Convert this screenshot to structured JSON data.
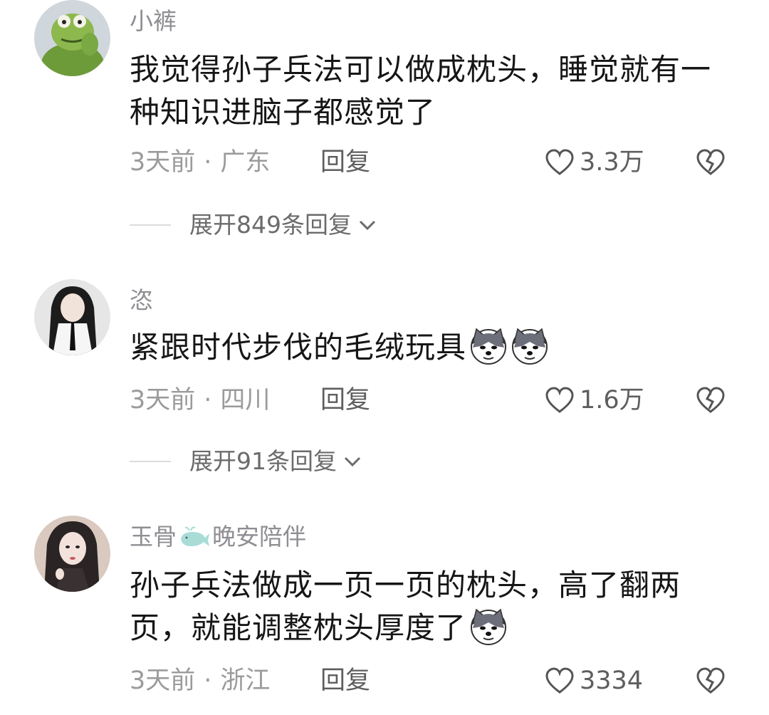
{
  "comments": [
    {
      "username": "小裤",
      "text": "我觉得孙子兵法可以做成枕头，睡觉就有一种知识进脑子都感觉了",
      "time": "3天前",
      "location": "广东",
      "reply_label": "回复",
      "likes": "3.3万",
      "expand_label": "展开849条回复"
    },
    {
      "username": "恣",
      "text": "紧跟时代步伐的毛绒玩具",
      "time": "3天前",
      "location": "四川",
      "reply_label": "回复",
      "likes": "1.6万",
      "expand_label": "展开91条回复"
    },
    {
      "username_part1": "玉骨",
      "username_part2": "晚安陪伴",
      "text": "孙子兵法做成一页一页的枕头，高了翻两页，就能调整枕头厚度了",
      "time": "3天前",
      "location": "浙江",
      "reply_label": "回复",
      "likes": "3334"
    }
  ],
  "separator": "·",
  "icons": {
    "like": "heart-outline-icon",
    "dislike": "broken-heart-icon",
    "expand": "chevron-down-icon",
    "emoji": "husky-dog-emoji",
    "whale": "whale-icon"
  },
  "colors": {
    "text": "#161616",
    "meta": "#9b9b9b",
    "action": "#5e5e5e"
  }
}
